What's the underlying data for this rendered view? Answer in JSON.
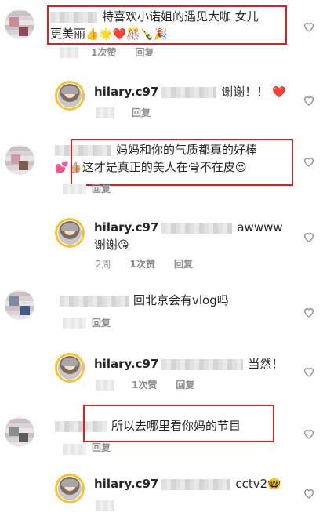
{
  "comments": [
    {
      "text_l1": "特喜欢小诺姐的遇见大咖 女儿",
      "text_l2": "更美丽",
      "emoji": "👍🌟❤️🎊🍾🎉",
      "likes": "1次赞",
      "reply": "回复"
    },
    {
      "text_l1": "妈妈和你的气质都真的好棒",
      "text_l2": "这才是真正的美人在骨不在皮",
      "emoji_pre": "💕👍🏼",
      "emoji_post": "😍",
      "reply": "回复"
    },
    {
      "text_l1": "回北京会有vlog吗",
      "reply": "回复"
    },
    {
      "text_l1": "所以去哪里看你妈的节目",
      "reply": "回复"
    }
  ],
  "replies": [
    {
      "username": "hilary.c97",
      "text": "谢谢！！",
      "emoji": "❤️",
      "reply": "回复"
    },
    {
      "username": "hilary.c97",
      "text_l1": "awwww",
      "text_l2": "谢谢",
      "emoji": "😘",
      "time": "2周",
      "likes": "1次赞",
      "reply": "回复"
    },
    {
      "username": "hilary.c97",
      "text": "当然！",
      "likes": "1次赞",
      "reply": "回复"
    },
    {
      "username": "hilary.c97",
      "text": "cctv2",
      "emoji": "🤓"
    }
  ],
  "colors": {
    "highlight": "#d0242a",
    "meta": "#8e8e8e",
    "text": "#262626",
    "avatar_ring": "#f5c23b"
  }
}
